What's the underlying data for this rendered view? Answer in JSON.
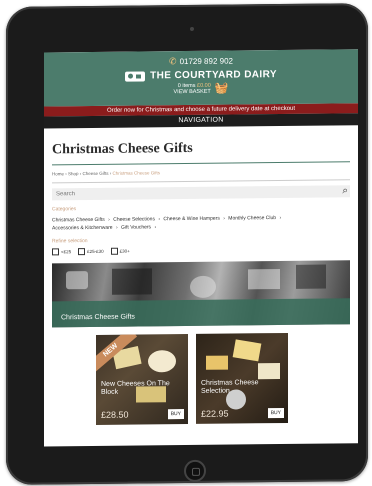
{
  "header": {
    "phone": "01729 892 902",
    "brand": "THE COURTYARD DAIRY",
    "basket_items": "0 items",
    "basket_total": "£0.00",
    "basket_link": "VIEW BASKET"
  },
  "promo": "Order now for Christmas and choose a future delivery date at checkout",
  "nav": "NAVIGATION",
  "page": {
    "title": "Christmas Cheese Gifts",
    "breadcrumb": [
      "Home",
      "Shop",
      "Cheese Gifts",
      "Christmas Cheese Gifts"
    ]
  },
  "search": {
    "placeholder": "Search"
  },
  "categories": {
    "label": "Categories",
    "items": [
      "Christmas Cheese Gifts",
      "Cheese Selections",
      "Cheese & Wine Hampers",
      "Monthly Cheese Club",
      "Accessories & Kitchenware",
      "Gift Vouchers"
    ]
  },
  "refine": {
    "label": "Refine selection",
    "options": [
      "<£25",
      "£25-£30",
      "£30+"
    ]
  },
  "banner": {
    "caption": "Christmas Cheese Gifts"
  },
  "products": [
    {
      "name": "New Cheeses On The Block",
      "price": "£28.50",
      "buy": "BUY",
      "badge": "NEW"
    },
    {
      "name": "Christmas Cheese Selection",
      "price": "£22.95",
      "buy": "BUY"
    }
  ],
  "colors": {
    "header": "#4c7c6c",
    "promo": "#8b1c1c",
    "nav": "#1d1d1d",
    "accent": "#c9a080"
  }
}
